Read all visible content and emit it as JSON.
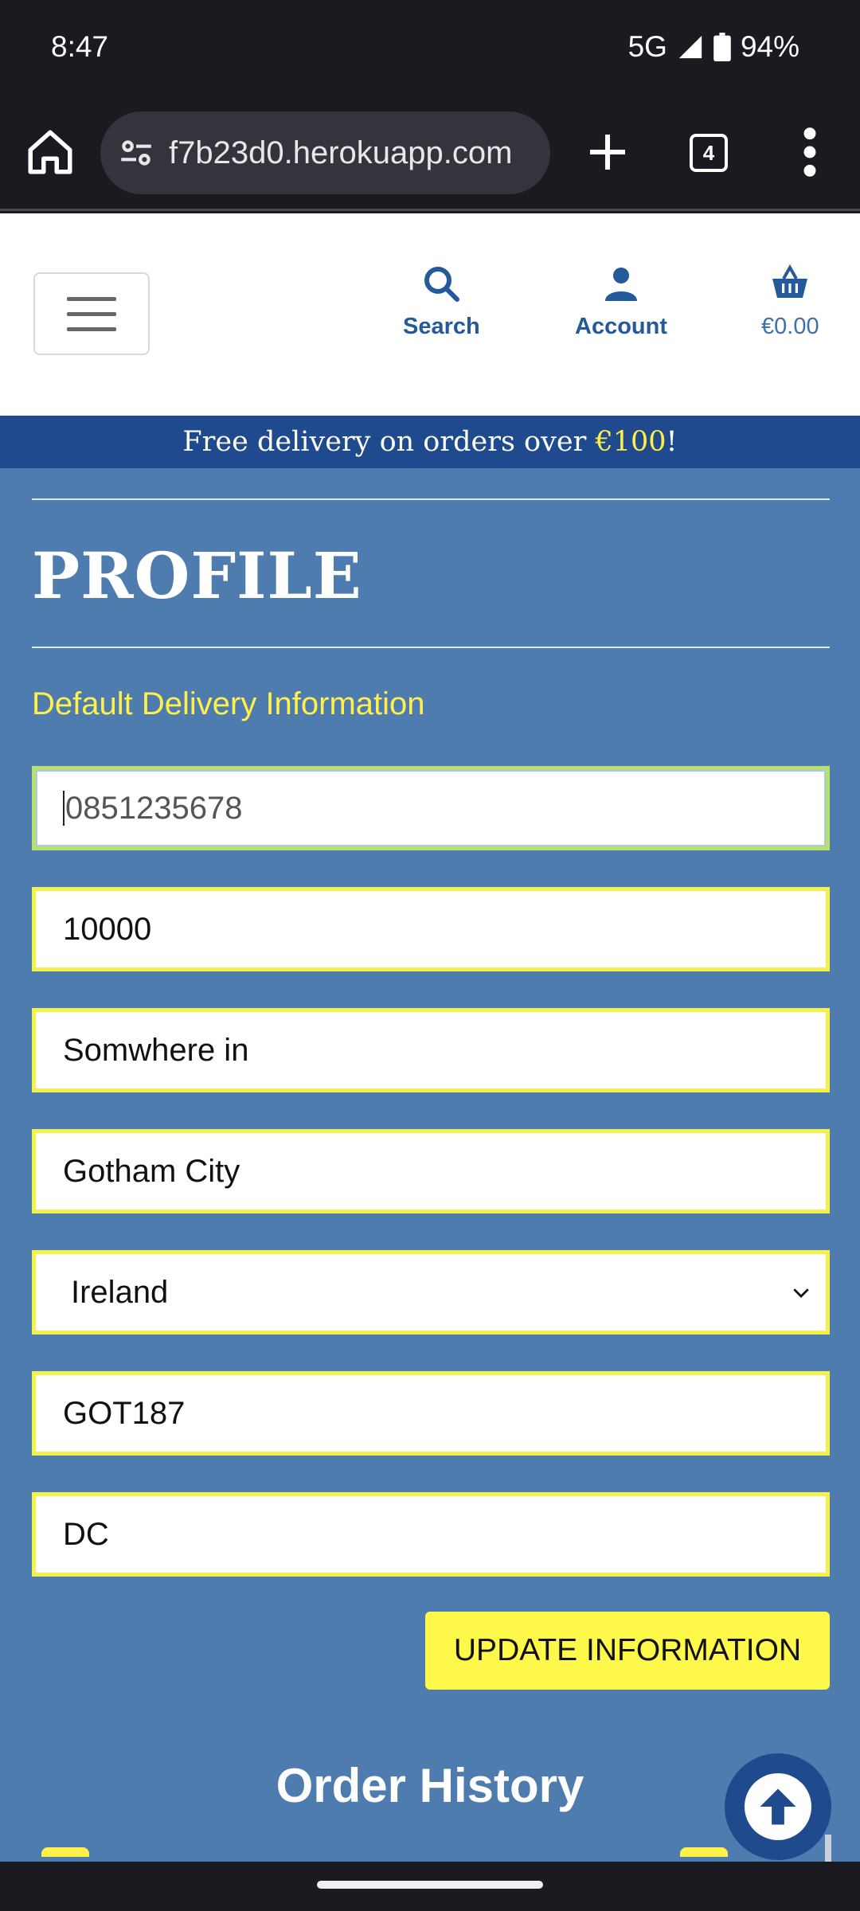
{
  "status_bar": {
    "time": "8:47",
    "network": "5G",
    "battery": "94%"
  },
  "browser": {
    "url": "f7b23d0.herokuapp.com",
    "tab_count": "4"
  },
  "header": {
    "nav": {
      "search_label": "Search",
      "account_label": "Account",
      "basket_total": "€0.00"
    },
    "brand_color": "#245a9a"
  },
  "promo": {
    "text_before": "Free delivery on orders over ",
    "highlight": "€100",
    "text_after": "!"
  },
  "profile": {
    "title": "PROFILE",
    "section_label": "Default Delivery Information",
    "fields": {
      "phone": "0851235678",
      "street1": "10000",
      "street2": "Somwhere in",
      "city": "Gotham City",
      "country": "Ireland",
      "postcode": "GOT187",
      "county": "DC"
    },
    "update_button": "UPDATE INFORMATION"
  },
  "order_history": {
    "title": "Order History"
  },
  "colors": {
    "content_bg": "#4e7caf",
    "accent_yellow": "#fdf84a",
    "banner_blue": "#1f4b8e"
  }
}
